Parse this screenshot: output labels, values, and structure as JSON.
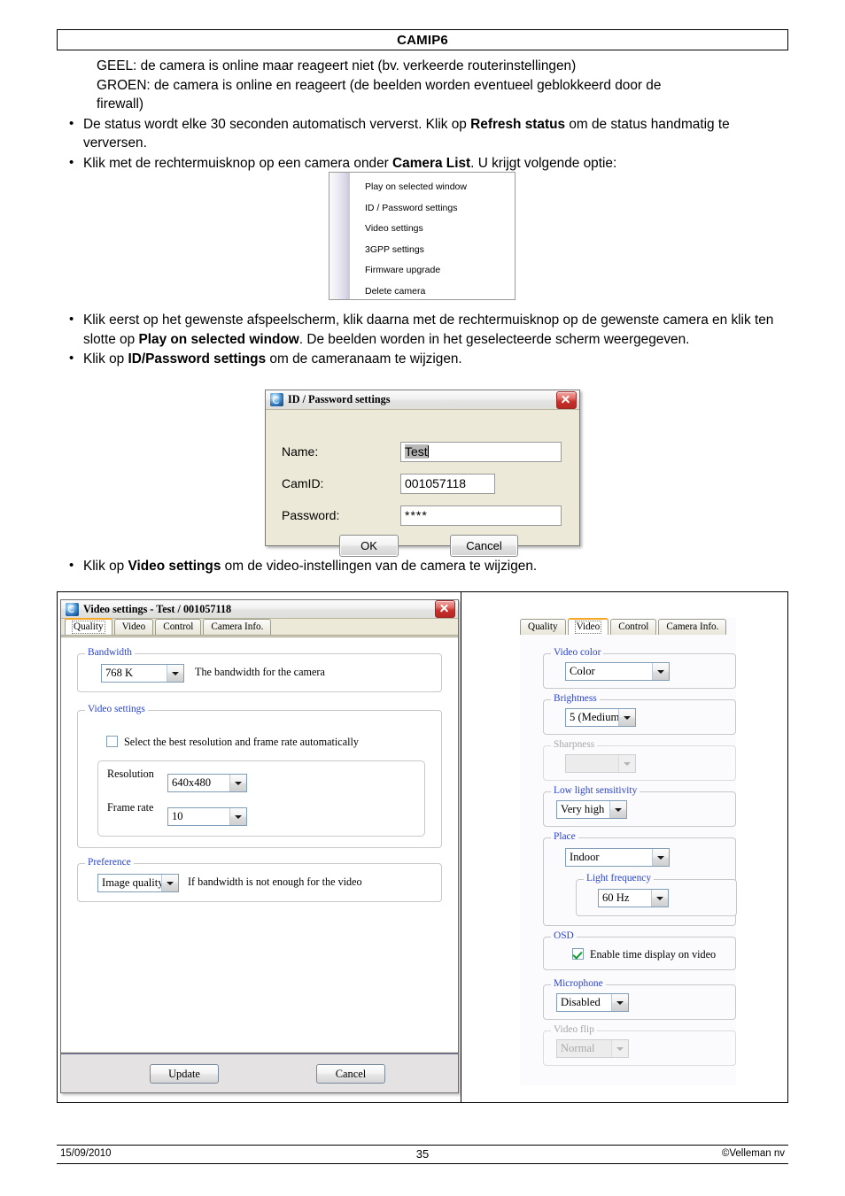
{
  "header": {
    "title": "CAMIP6"
  },
  "body": {
    "status_lines": [
      "GEEL: de camera is online maar reageert niet (bv. verkeerde routerinstellingen)",
      "GROEN: de camera is online en reageert (de beelden worden eventueel geblokkeerd door de",
      "firewall)"
    ],
    "bullet1": {
      "pre": "De status wordt elke 30 seconden automatisch ververst. Klik op ",
      "bold": "Refresh status",
      "post": " om de status handmatig te verversen."
    },
    "bullet2": {
      "pre": "Klik met de rechtermuisknop op een camera onder ",
      "bold": "Camera List",
      "post": ". U krijgt volgende optie:"
    },
    "bullet3": {
      "pre": "Klik eerst op het gewenste afspeelscherm, klik daarna met de rechtermuisknop op de gewenste camera en klik ten slotte op ",
      "bold": "Play on selected window",
      "post": ". De beelden worden in het geselecteerde scherm weergegeven."
    },
    "bullet4": {
      "pre": "Klik op ",
      "bold": "ID/Password settings",
      "post": " om de cameranaam te wijzigen."
    },
    "bullet5": {
      "pre": "Klik op ",
      "bold": "Video settings",
      "post": " om de video-instellingen van de camera te wijzigen."
    }
  },
  "context_menu": {
    "items": [
      "Play on selected window",
      "ID / Password settings",
      "Video settings",
      "3GPP settings",
      "Firmware upgrade",
      "Delete camera"
    ]
  },
  "id_password_dialog": {
    "title": "ID / Password settings",
    "fields": [
      {
        "label": "Name:",
        "value": "Test"
      },
      {
        "label": "CamID:",
        "value": "001057118"
      },
      {
        "label": "Password:",
        "value": "****"
      }
    ],
    "ok_label": "OK",
    "cancel_label": "Cancel"
  },
  "video_settings_window": {
    "title": "Video settings - Test / 001057118",
    "tabs": [
      {
        "label": "Quality",
        "active": true
      },
      {
        "label": "Video",
        "active": false
      },
      {
        "label": "Control",
        "active": false
      },
      {
        "label": "Camera Info.",
        "active": false
      }
    ],
    "quality_tab": {
      "bandwidth": {
        "group_title": "Bandwidth",
        "value": "768 K",
        "hint": "The bandwidth for the camera"
      },
      "video_settings": {
        "group_title": "Video settings",
        "auto_checkbox_label": "Select the best resolution and frame rate automatically",
        "auto_checkbox_checked": false,
        "resolution_label": "Resolution",
        "resolution_value": "640x480",
        "framerate_label": "Frame rate",
        "framerate_value": "10"
      },
      "preference": {
        "group_title": "Preference",
        "value": "Image quality",
        "hint": "If bandwidth is not enough for the video"
      }
    },
    "update_label": "Update",
    "cancel_label": "Cancel"
  },
  "video_tab_panel": {
    "tabs": [
      {
        "label": "Quality",
        "active": false
      },
      {
        "label": "Video",
        "active": true
      },
      {
        "label": "Control",
        "active": false
      },
      {
        "label": "Camera Info.",
        "active": false
      }
    ],
    "video_color": {
      "group_title": "Video color",
      "value": "Color",
      "disabled": false
    },
    "brightness": {
      "group_title": "Brightness",
      "value": "5 (Medium",
      "disabled": false
    },
    "sharpness": {
      "group_title": "Sharpness",
      "value": "",
      "disabled": true
    },
    "low_light": {
      "group_title": "Low light sensitivity",
      "value": "Very high",
      "disabled": false
    },
    "place": {
      "group_title": "Place",
      "value": "Indoor",
      "light_frequency": {
        "group_title": "Light frequency",
        "value": "60 Hz"
      }
    },
    "osd": {
      "group_title": "OSD",
      "checkbox_label": "Enable time display on video",
      "checked": true
    },
    "microphone": {
      "group_title": "Microphone",
      "value": "Disabled",
      "disabled": false
    },
    "video_flip": {
      "group_title": "Video flip",
      "value": "Normal",
      "disabled": true
    }
  },
  "footer": {
    "date": "15/09/2010",
    "page": "35",
    "copyright": "©Velleman nv"
  },
  "colors": {
    "accent_tab": "#f5a623",
    "group_label": "#2b44c8",
    "close_button": "#c8302a",
    "check_green": "#0a9e28"
  }
}
